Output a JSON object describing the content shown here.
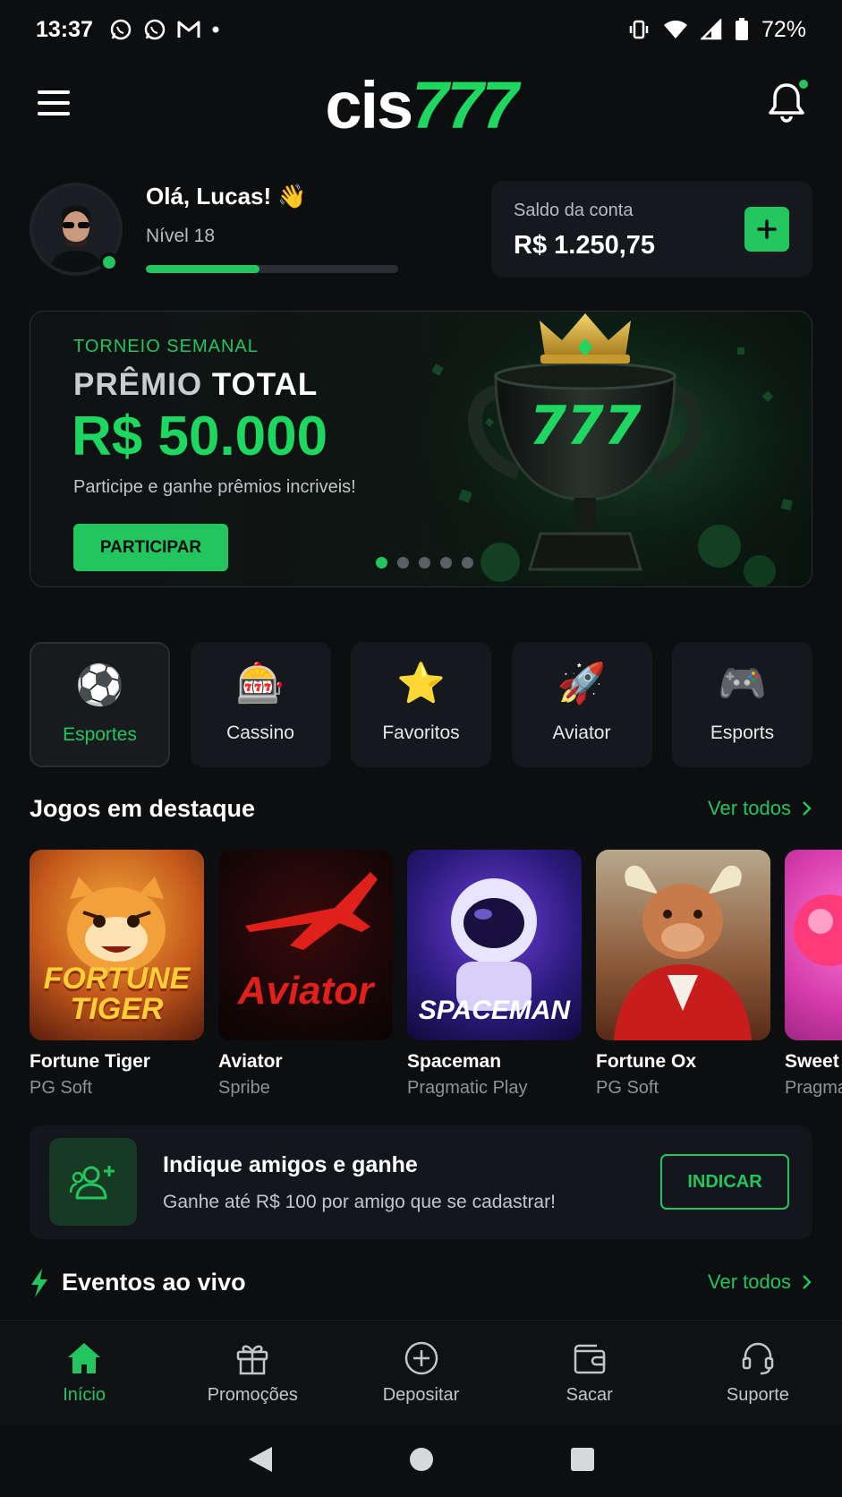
{
  "status_bar": {
    "time": "13:37",
    "battery": "72%",
    "notification_icons": [
      "whatsapp-icon",
      "whatsapp-icon",
      "gmail-icon",
      "dot-icon"
    ],
    "system_icons": [
      "vibrate-icon",
      "wifi-icon",
      "signal-icon",
      "battery-icon"
    ]
  },
  "header": {
    "logo_part1": "cis",
    "logo_part2": "777",
    "notification_badge": true
  },
  "profile": {
    "greeting": "Olá, Lucas! 👋",
    "level": "Nível 18",
    "level_progress": 0.45,
    "online": true
  },
  "balance": {
    "label": "Saldo da conta",
    "value": "R$ 1.250,75",
    "add_label": "+"
  },
  "banner": {
    "tag": "TORNEIO SEMANAL",
    "title_light": "PRÊMIO",
    "title_bold": "TOTAL",
    "prize": "R$ 50.000",
    "subtitle": "Participe e ganhe prêmios incriveis!",
    "cta": "PARTICIPAR",
    "trophy_text": "777",
    "slides": 5,
    "active_slide": 0
  },
  "categories": [
    {
      "label": "Esportes",
      "icon": "soccer-ball-icon",
      "glyph": "⚽",
      "active": true
    },
    {
      "label": "Cassino",
      "icon": "slot-machine-icon",
      "glyph": "🎰",
      "active": false
    },
    {
      "label": "Favoritos",
      "icon": "star-icon",
      "glyph": "⭐",
      "active": false
    },
    {
      "label": "Aviator",
      "icon": "rocket-icon",
      "glyph": "🚀",
      "active": false
    },
    {
      "label": "Esports",
      "icon": "gamepad-icon",
      "glyph": "🎮",
      "active": false
    }
  ],
  "featured": {
    "title": "Jogos em destaque",
    "see_all": "Ver todos",
    "games": [
      {
        "name": "Fortune Tiger",
        "provider": "PG Soft",
        "art": "FORTUNE\nTIGER"
      },
      {
        "name": "Aviator",
        "provider": "Spribe",
        "art": "Aviator"
      },
      {
        "name": "Spaceman",
        "provider": "Pragmatic Play",
        "art": "SPACEMAN"
      },
      {
        "name": "Fortune Ox",
        "provider": "PG Soft",
        "art": ""
      },
      {
        "name": "Sweet",
        "provider": "Pragma",
        "art": ""
      }
    ]
  },
  "referral": {
    "title": "Indique amigos e ganhe",
    "subtitle": "Ganhe até R$ 100 por amigo que se cadastrar!",
    "button": "INDICAR"
  },
  "live": {
    "title": "Eventos ao vivo",
    "see_all": "Ver todos"
  },
  "bottom_nav": [
    {
      "label": "Início",
      "icon": "home-icon",
      "active": true
    },
    {
      "label": "Promoções",
      "icon": "gift-icon",
      "active": false
    },
    {
      "label": "Depositar",
      "icon": "plus-circle-icon",
      "active": false
    },
    {
      "label": "Sacar",
      "icon": "wallet-icon",
      "active": false
    },
    {
      "label": "Suporte",
      "icon": "headset-icon",
      "active": false
    }
  ],
  "colors": {
    "accent": "#22c55e",
    "background": "#0c0e10",
    "surface": "#15181c"
  }
}
